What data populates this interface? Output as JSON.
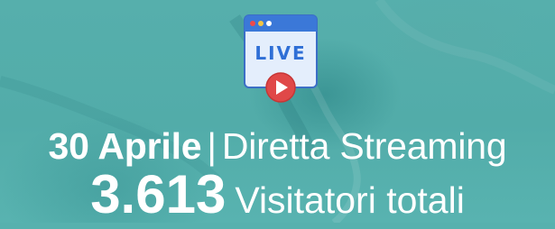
{
  "banner": {
    "icon": {
      "name": "live-stream-icon",
      "screen_text": "LIVE",
      "dots_colors": [
        "#ef4a4a",
        "#f4c542",
        "#ffffff"
      ],
      "frame_color": "#e4eefc",
      "header_color": "#3b78d8",
      "text_color": "#2f6fd6",
      "play_color": "#e04848"
    },
    "date": "30 Aprile",
    "separator": "|",
    "subtitle": "Diretta Streaming",
    "visitors_count": "3.613",
    "visitors_label": "Visitatori totali",
    "colors": {
      "background": "#57b1ae",
      "text": "#ffffff"
    }
  }
}
